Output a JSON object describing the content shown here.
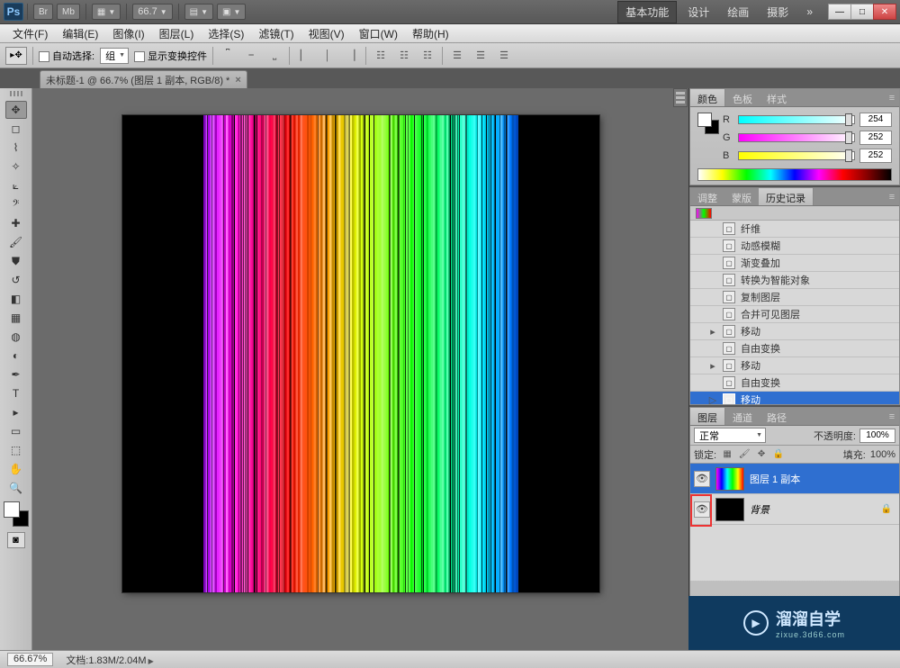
{
  "app": {
    "logo": "Ps"
  },
  "titlebar": {
    "zoom_preset": "66.7",
    "modes": [
      "基本功能",
      "设计",
      "绘画",
      "摄影"
    ],
    "more": "»"
  },
  "menu": {
    "items": [
      "文件(F)",
      "编辑(E)",
      "图像(I)",
      "图层(L)",
      "选择(S)",
      "滤镜(T)",
      "视图(V)",
      "窗口(W)",
      "帮助(H)"
    ]
  },
  "options": {
    "auto_select": "自动选择:",
    "group": "组",
    "show_transform": "显示变换控件"
  },
  "doc_tab": {
    "title": "未标题-1 @ 66.7% (图层 1 副本, RGB/8) *"
  },
  "panels": {
    "color": {
      "tabs": [
        "颜色",
        "色板",
        "样式"
      ],
      "channels": [
        {
          "label": "R",
          "value": "254",
          "grad": "linear-gradient(90deg,#0ff,#fff)"
        },
        {
          "label": "G",
          "value": "252",
          "grad": "linear-gradient(90deg,#f0f,#fff)"
        },
        {
          "label": "B",
          "value": "252",
          "grad": "linear-gradient(90deg,#ff0,#fff)"
        }
      ]
    },
    "history": {
      "tabs": [
        "调整",
        "蒙版",
        "历史记录"
      ],
      "active_tab": 2,
      "items": [
        {
          "label": "纤维"
        },
        {
          "label": "动感模糊"
        },
        {
          "label": "渐变叠加"
        },
        {
          "label": "转换为智能对象"
        },
        {
          "label": "复制图层"
        },
        {
          "label": "合并可见图层"
        },
        {
          "label": "移动",
          "caret": true
        },
        {
          "label": "自由变换"
        },
        {
          "label": "移动",
          "caret": true
        },
        {
          "label": "自由变换"
        },
        {
          "label": "移动",
          "selected": true,
          "caret": true
        }
      ]
    },
    "layers": {
      "tabs": [
        "图层",
        "通道",
        "路径"
      ],
      "blend": "正常",
      "opacity_label": "不透明度:",
      "opacity": "100%",
      "lock_label": "锁定:",
      "fill_label": "填充:",
      "fill": "100%",
      "rows": [
        {
          "name": "图层 1 副本",
          "selected": true,
          "thumb": "rainbow"
        },
        {
          "name": "背景",
          "locked": true,
          "thumb": "black",
          "italic": true
        }
      ]
    }
  },
  "watermark": {
    "brand": "溜溜自学",
    "sub": "zixue.3d66.com"
  },
  "status": {
    "zoom": "66.67%",
    "doc_label": "文档:",
    "doc": "1.83M/2.04M"
  }
}
